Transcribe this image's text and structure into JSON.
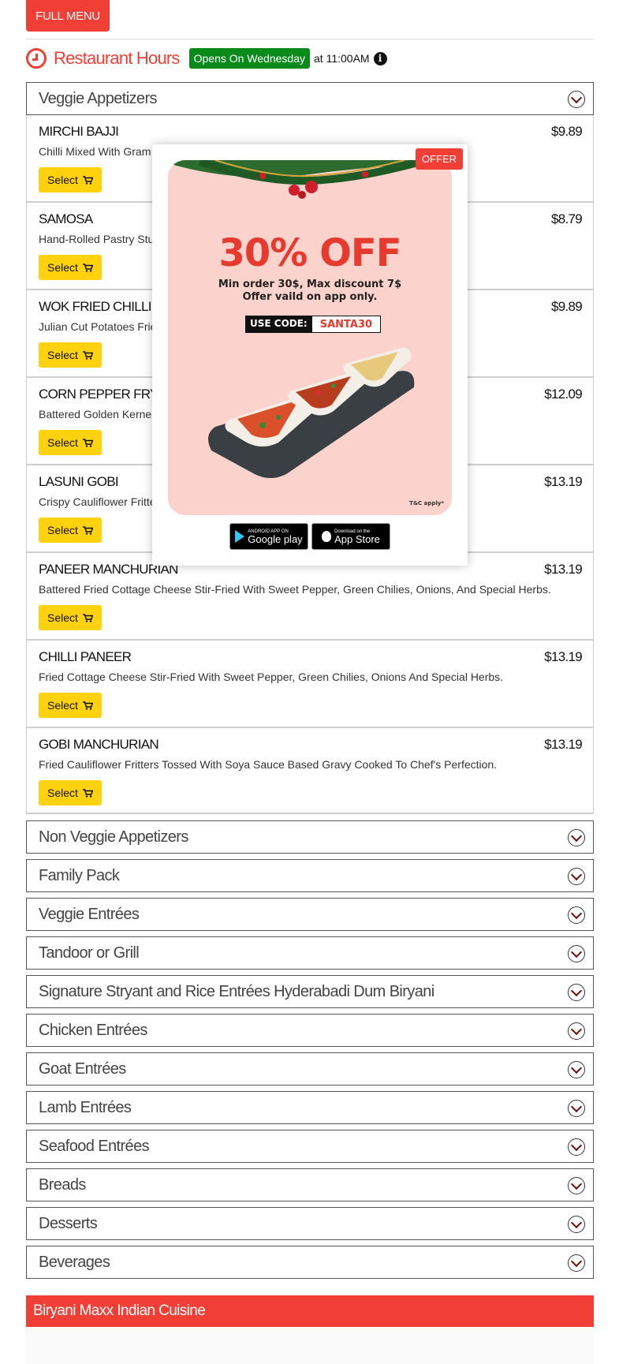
{
  "top": {
    "full_menu_label": "FULL MENU"
  },
  "hours": {
    "title": "Restaurant Hours",
    "status_badge": "Opens On Wednesday",
    "time_text": "at 11:00AM",
    "info_glyph": "i"
  },
  "open_category": {
    "title": "Veggie Appetizers",
    "items": [
      {
        "name": "MIRCHI BAJJI",
        "price": "$9.89",
        "desc": "Chilli Mixed With Gram",
        "select": "Select"
      },
      {
        "name": "SAMOSA",
        "price": "$8.79",
        "desc": "Hand-Rolled Pastry Stu",
        "select": "Select"
      },
      {
        "name": "WOK FRIED CHILLI POTA",
        "price": "$9.89",
        "desc": "Julian Cut Potatoes Frie",
        "select": "Select"
      },
      {
        "name": "CORN PEPPER FRY",
        "price": "$12.09",
        "desc": "Battered Golden Kernel",
        "select": "Select"
      },
      {
        "name": "LASUNI GOBI",
        "price": "$13.19",
        "desc": "Crispy Cauliflower Fritte",
        "select": "Select"
      },
      {
        "name": "PANEER MANCHURIAN",
        "price": "$13.19",
        "desc": "Battered Fried Cottage Cheese Stir-Fried With Sweet Pepper, Green Chilies, Onions, And Special Herbs.",
        "select": "Select"
      },
      {
        "name": "CHILLI PANEER",
        "price": "$13.19",
        "desc": "Fried Cottage Cheese Stir-Fried With Sweet Pepper, Green Chilies, Onions And Special Herbs.",
        "select": "Select"
      },
      {
        "name": "GOBI MANCHURIAN",
        "price": "$13.19",
        "desc": "Fried Cauliflower Fritters Tossed With Soya Sauce Based Gravy Cooked To Chef's Perfection.",
        "select": "Select"
      }
    ]
  },
  "categories": [
    "Non Veggie Appetizers",
    "Family Pack",
    "Veggie Entrées",
    "Tandoor or Grill",
    "Signature Stryant and Rice Entrées Hyderabadi Dum Biryani",
    "Chicken Entrées",
    "Goat Entrées",
    "Lamb Entrées",
    "Seafood Entrées",
    "Breads",
    "Desserts",
    "Beverages"
  ],
  "footer": {
    "title": "Biryani Maxx Indian Cuisine"
  },
  "modal": {
    "tag": "OFFER",
    "percent": "30% OFF",
    "line1": "Min order 30$, Max discount 7$",
    "line2": "Offer vaild on app only.",
    "code_label": "USE CODE:",
    "code_value": "SANTA30",
    "tc": "T&C apply*",
    "google_small": "ANDROID APP ON",
    "google_big": "Google play",
    "apple_small": "Download on the",
    "apple_big": "App Store"
  },
  "colors": {
    "accent": "#f23f35",
    "select": "#ffd20d",
    "badge": "#0b8a1c",
    "poster_bg": "#fbd2cc"
  }
}
